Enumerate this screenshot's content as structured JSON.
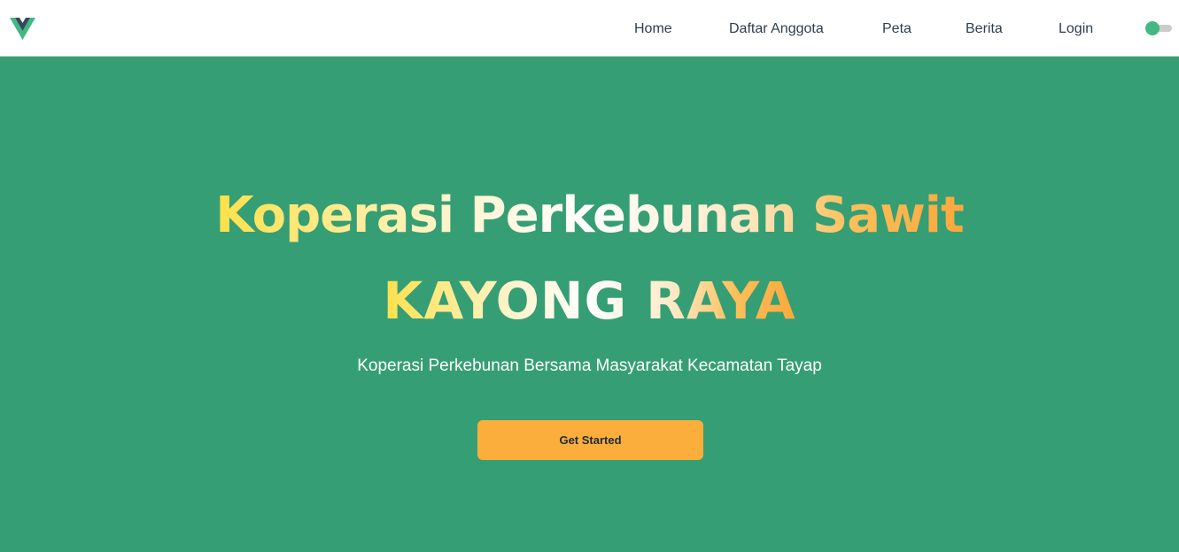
{
  "nav": {
    "logo_icon": "vue-logo-icon",
    "links": [
      {
        "label": "Home"
      },
      {
        "label": "Daftar Anggota"
      },
      {
        "label": "Peta"
      },
      {
        "label": "Berita"
      },
      {
        "label": "Login"
      }
    ],
    "theme_toggle_icon": "toggle-switch-icon"
  },
  "hero": {
    "title_line1": "Koperasi Perkebunan Sawit",
    "title_line2": "KAYONG RAYA",
    "subtitle": "Koperasi Perkebunan Bersama Masyarakat Kecamatan Tayap",
    "cta_label": "Get Started"
  },
  "colors": {
    "hero_background": "#369e74",
    "accent_green": "#42b883",
    "button_orange": "#fbae3c",
    "gradient_start": "#fde047",
    "gradient_end": "#fba73b"
  }
}
